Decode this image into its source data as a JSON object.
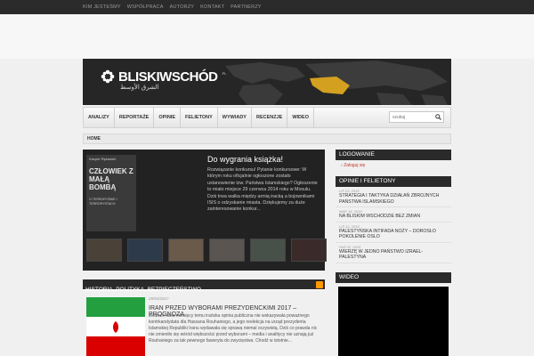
{
  "topnav": [
    "KIM JESTEŚMY",
    "WSPÓŁPRACA",
    "AUTORZY",
    "KONTAKT",
    "PARTNERZY"
  ],
  "logo": {
    "name_bold": "BLISKI",
    "name_rest": "WSCHÓD",
    "suffix": ".PL",
    "arabic": "الشرق الأوسط"
  },
  "nav": [
    "ANALIZY",
    "REPORTAŻE",
    "OPINIE",
    "FELIETONY",
    "WYWIADY",
    "RECENZJE",
    "WIDEO"
  ],
  "search": {
    "placeholder": "szukaj"
  },
  "breadcrumb": "HOME",
  "feature": {
    "title": "Do wygrania książka!",
    "text": "Rozwiązanie konkursu! Pytanie konkursowe: W którym roku oficjalnie ogłoszone zostało ustanowienie tzw. Państwa Islamskiego? Ogłoszenie to miało miejsce 29 czerwca 2014 roku w Mosulu. Dziś trwa walka między armią iracką a bojownikami ISIS o odzyskanie miasta. Dziękujemy za duże zainteresowanie konkur...",
    "book": {
      "author": "Kacper Rękawek",
      "title": "CZŁOWIEK Z MAŁĄ BOMBĄ",
      "subtitle": "O TERRORYŹMIE I TERRORYSTACH"
    }
  },
  "section_title": "HISTORIA, POLITYKA, BEZPIECZEŃSTWO",
  "article": {
    "date": "28/04/2017",
    "title": "IRAN PRZED WYBORAMI PREZYDENCKIMI 2017 – PROGNOZA",
    "text": "Jeszcze kilka miesięcy temu irańska opinia publiczna nie wskazywała poważnego kontrkandydata dla Hassana Rouhaniego, a jego reelekcja na urząd prezydenta Islamskiej Republiki Iranu wydawała się sprawą niemal oczywistą. Dziś co prawda nic nie zmieniło się wśród większości przed wyborami – media i analitycy nie uznają już Rouhaniego za tak pewnego faworyta do zwycięstwa. Chodź w istotnie..."
  },
  "sidebar": {
    "login_title": "LOGOWANIE",
    "login_link": "Zaloguj się",
    "opinions_title": "OPINIE I FELIETONY",
    "opinions": [
      {
        "date": "LIP 23, 2016",
        "title": "STRATEGIA I TAKTYKA DZIAŁAŃ ZBROJNYCH PAŃSTWA ISLAMSKIEGO"
      },
      {
        "date": "MAR 16, 2016",
        "title": "NA BLISKIM WSCHODZIE BEZ ZMIAN"
      },
      {
        "date": "LIS 12, 2015",
        "title": "PALESTYŃSKA INTIFADA NOŻY – DOROSŁO POKOLENIE OSLO"
      },
      {
        "date": "PAŹ 02, 2015",
        "title": "WIERZĘ W JEDNO PAŃSTWO IZRAEL-PALESTYNA"
      }
    ],
    "video_title": "WIDEO"
  },
  "colors": {
    "accent": "#c0392b",
    "dark": "#2a2a2a",
    "rss": "#ff9900",
    "map_highlight": "#d4a020"
  }
}
